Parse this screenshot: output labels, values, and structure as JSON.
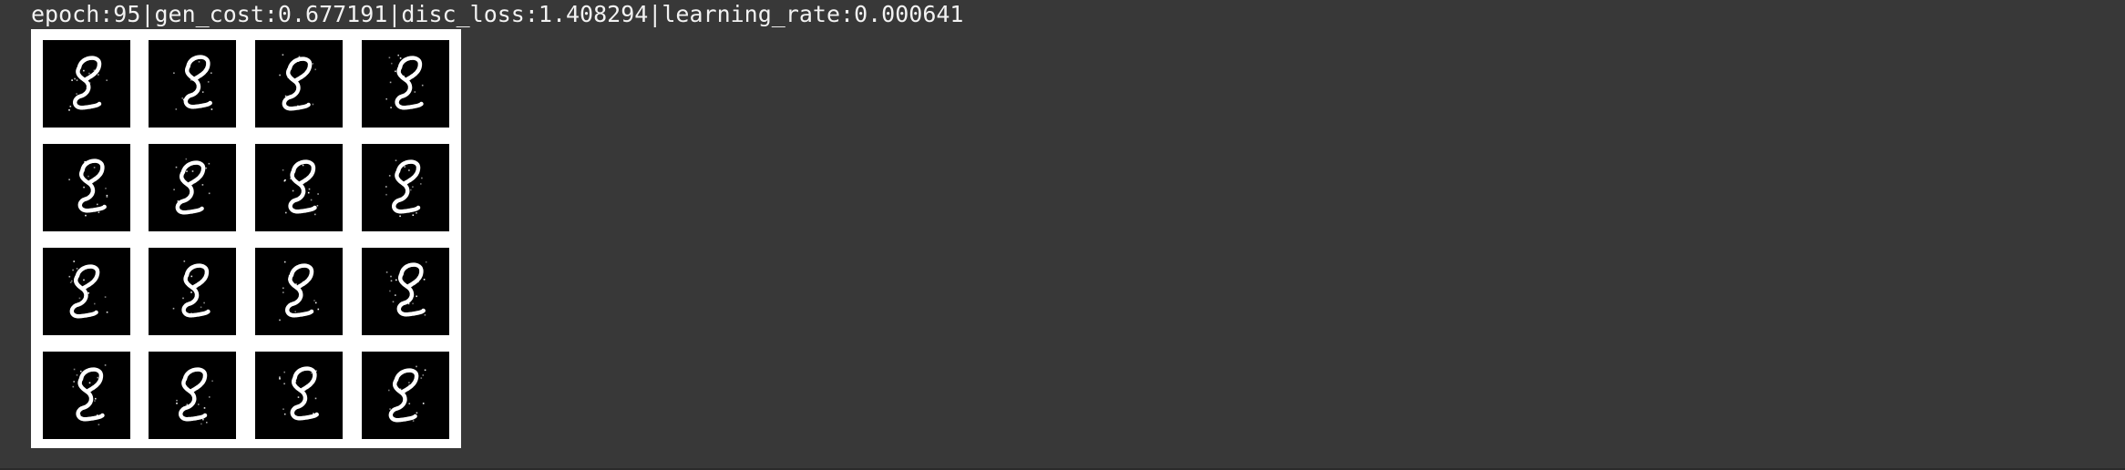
{
  "output": {
    "log_line": "epoch:95|gen_cost:0.677191|disc_loss:1.408294|learning_rate:0.000641"
  },
  "figure": {
    "rows": 4,
    "cols": 4,
    "tile_count": 16,
    "background_color": "#ffffff",
    "tile_color": "#000000",
    "digit_color": "#ffffff",
    "page_background": "#383838"
  }
}
